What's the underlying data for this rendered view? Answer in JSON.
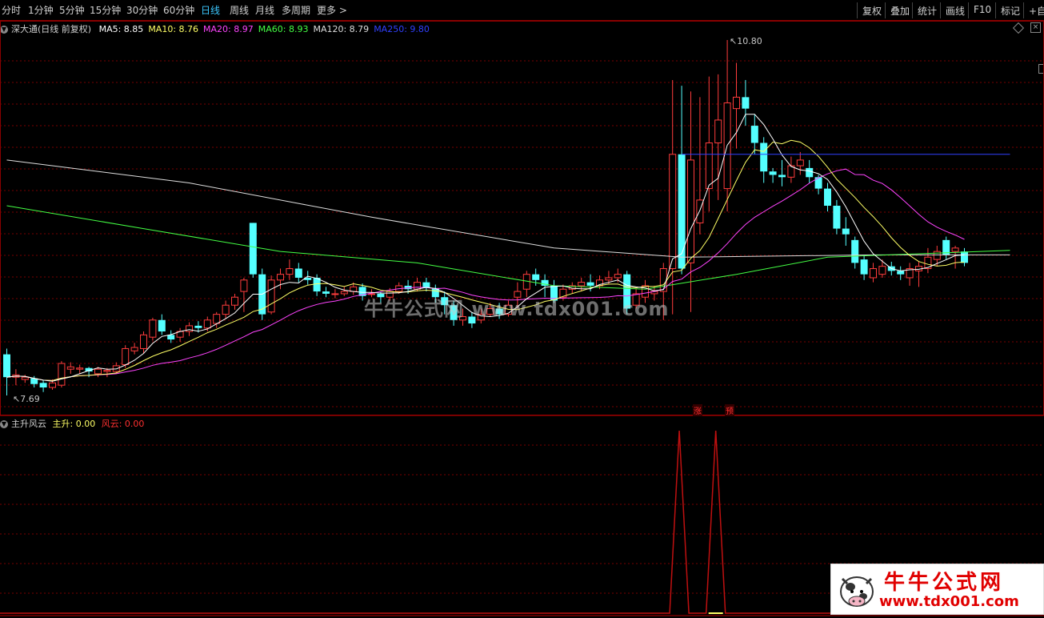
{
  "toolbar": {
    "periods": [
      "分时",
      "1分钟",
      "5分钟",
      "15分钟",
      "30分钟",
      "60分钟",
      "日线",
      "周线",
      "月线",
      "多周期",
      "更多 >"
    ],
    "active_period": "日线",
    "right_buttons": [
      "复权",
      "叠加",
      "统计",
      "画线",
      "F10",
      "标记",
      "+自"
    ]
  },
  "legend": {
    "title": "深大通(日线 前复权)",
    "ma": [
      {
        "label": "MA5: 8.85",
        "color": "#ffffff"
      },
      {
        "label": "MA10: 8.76",
        "color": "#ffff66"
      },
      {
        "label": "MA20: 8.97",
        "color": "#ff44ff"
      },
      {
        "label": "MA60: 8.93",
        "color": "#44ff44"
      },
      {
        "label": "MA120: 8.79",
        "color": "#dddddd"
      },
      {
        "label": "MA250: 9.80",
        "color": "#3040ff"
      }
    ]
  },
  "indicator_legend": {
    "name": "主升风云",
    "s1": "主升: 0.00",
    "s1_color": "#ffff66",
    "s2": "风云: 0.00",
    "s2_color": "#ff3030"
  },
  "price_marks": {
    "high": "10.80",
    "low": "7.69"
  },
  "signal_marks": [
    "涨",
    "预"
  ],
  "watermark": "牛牛公式网 www.tdx001.com",
  "logo": {
    "title": "牛牛公式网",
    "url": "www.tdx001.com"
  },
  "colors": {
    "up": "#ff3c3c",
    "down": "#54ffff",
    "grid": "#7a0000",
    "signal": "#c01010"
  },
  "chart_data": {
    "type": "candlestick",
    "candles": [
      [
        8.05,
        7.85,
        8.1,
        7.69
      ],
      [
        7.85,
        7.87,
        7.92,
        7.78
      ],
      [
        7.83,
        7.85,
        7.87,
        7.8
      ],
      [
        7.84,
        7.79,
        7.86,
        7.76
      ],
      [
        7.8,
        7.76,
        7.82,
        7.72
      ],
      [
        7.76,
        7.8,
        7.83,
        7.74
      ],
      [
        7.78,
        7.97,
        7.99,
        7.76
      ],
      [
        7.92,
        7.94,
        7.98,
        7.88
      ],
      [
        7.92,
        7.93,
        7.96,
        7.88
      ],
      [
        7.93,
        7.9,
        7.94,
        7.85
      ],
      [
        7.88,
        7.92,
        7.94,
        7.85
      ],
      [
        7.9,
        7.91,
        7.93,
        7.85
      ],
      [
        7.9,
        7.95,
        7.98,
        7.88
      ],
      [
        7.96,
        8.1,
        8.13,
        7.93
      ],
      [
        8.08,
        8.11,
        8.15,
        8.05
      ],
      [
        8.1,
        8.22,
        8.25,
        8.06
      ],
      [
        8.2,
        8.35,
        8.37,
        8.17
      ],
      [
        8.35,
        8.25,
        8.4,
        8.22
      ],
      [
        8.22,
        8.18,
        8.26,
        8.15
      ],
      [
        8.2,
        8.25,
        8.28,
        8.16
      ],
      [
        8.25,
        8.3,
        8.33,
        8.21
      ],
      [
        8.3,
        8.28,
        8.34,
        8.24
      ],
      [
        8.28,
        8.35,
        8.38,
        8.25
      ],
      [
        8.32,
        8.4,
        8.42,
        8.28
      ],
      [
        8.4,
        8.48,
        8.52,
        8.36
      ],
      [
        8.48,
        8.55,
        8.58,
        8.44
      ],
      [
        8.6,
        8.7,
        8.72,
        8.42
      ],
      [
        9.2,
        8.75,
        9.2,
        8.72
      ],
      [
        8.75,
        8.4,
        8.8,
        8.35
      ],
      [
        8.42,
        8.7,
        8.74,
        8.4
      ],
      [
        8.7,
        8.75,
        8.8,
        8.62
      ],
      [
        8.75,
        8.8,
        8.88,
        8.7
      ],
      [
        8.8,
        8.72,
        8.85,
        8.68
      ],
      [
        8.72,
        8.7,
        8.78,
        8.66
      ],
      [
        8.72,
        8.6,
        8.75,
        8.56
      ],
      [
        8.6,
        8.58,
        8.64,
        8.55
      ],
      [
        8.58,
        8.58,
        8.62,
        8.54
      ],
      [
        8.58,
        8.6,
        8.64,
        8.56
      ],
      [
        8.6,
        8.64,
        8.68,
        8.57
      ],
      [
        8.64,
        8.56,
        8.67,
        8.52
      ],
      [
        8.58,
        8.58,
        8.62,
        8.55
      ],
      [
        8.58,
        8.55,
        8.6,
        8.5
      ],
      [
        8.55,
        8.6,
        8.63,
        8.52
      ],
      [
        8.6,
        8.65,
        8.68,
        8.58
      ],
      [
        8.65,
        8.62,
        8.7,
        8.58
      ],
      [
        8.62,
        8.68,
        8.72,
        8.6
      ],
      [
        8.68,
        8.63,
        8.72,
        8.6
      ],
      [
        8.63,
        8.55,
        8.66,
        8.5
      ],
      [
        8.55,
        8.48,
        8.6,
        8.4
      ],
      [
        8.48,
        8.35,
        8.52,
        8.3
      ],
      [
        8.35,
        8.38,
        8.45,
        8.3
      ],
      [
        8.38,
        8.32,
        8.42,
        8.28
      ],
      [
        8.35,
        8.4,
        8.45,
        8.32
      ],
      [
        8.4,
        8.45,
        8.5,
        8.38
      ],
      [
        8.45,
        8.4,
        8.5,
        8.36
      ],
      [
        8.4,
        8.48,
        8.52,
        8.38
      ],
      [
        8.55,
        8.6,
        8.68,
        8.45
      ],
      [
        8.62,
        8.75,
        8.78,
        8.55
      ],
      [
        8.75,
        8.7,
        8.8,
        8.65
      ],
      [
        8.7,
        8.65,
        8.75,
        8.55
      ],
      [
        8.65,
        8.52,
        8.7,
        8.5
      ],
      [
        8.55,
        8.62,
        8.66,
        8.52
      ],
      [
        8.62,
        8.65,
        8.68,
        8.58
      ],
      [
        8.65,
        8.68,
        8.72,
        8.6
      ],
      [
        8.68,
        8.65,
        8.75,
        8.6
      ],
      [
        8.65,
        8.7,
        8.74,
        8.62
      ],
      [
        8.7,
        8.72,
        8.78,
        8.66
      ],
      [
        8.72,
        8.75,
        8.8,
        8.68
      ],
      [
        8.75,
        8.45,
        8.78,
        8.4
      ],
      [
        8.48,
        8.58,
        8.62,
        8.45
      ],
      [
        8.55,
        8.65,
        8.7,
        8.5
      ],
      [
        8.58,
        8.6,
        8.65,
        8.52
      ],
      [
        8.6,
        8.8,
        8.85,
        8.35
      ],
      [
        8.8,
        9.8,
        10.45,
        8.4
      ],
      [
        9.8,
        8.8,
        10.4,
        8.75
      ],
      [
        8.85,
        9.75,
        10.35,
        8.42
      ],
      [
        9.2,
        9.4,
        10.3,
        9.1
      ],
      [
        9.5,
        9.9,
        10.48,
        9.3
      ],
      [
        9.9,
        10.1,
        10.5,
        9.4
      ],
      [
        9.5,
        10.25,
        10.8,
        9.3
      ],
      [
        10.2,
        10.3,
        10.6,
        9.85
      ],
      [
        10.3,
        10.2,
        10.45,
        10.05
      ],
      [
        10.05,
        9.9,
        10.15,
        9.8
      ],
      [
        9.9,
        9.65,
        9.95,
        9.55
      ],
      [
        9.65,
        9.62,
        9.68,
        9.55
      ],
      [
        9.62,
        9.6,
        9.75,
        9.52
      ],
      [
        9.6,
        9.7,
        9.78,
        9.55
      ],
      [
        9.7,
        9.75,
        9.82,
        9.62
      ],
      [
        9.68,
        9.6,
        9.75,
        9.55
      ],
      [
        9.6,
        9.5,
        9.62,
        9.45
      ],
      [
        9.5,
        9.35,
        9.55,
        9.3
      ],
      [
        9.35,
        9.15,
        9.4,
        9.1
      ],
      [
        9.15,
        9.1,
        9.25,
        9.0
      ],
      [
        9.05,
        8.85,
        9.08,
        8.8
      ],
      [
        8.88,
        8.75,
        8.92,
        8.7
      ],
      [
        8.72,
        8.8,
        8.85,
        8.68
      ],
      [
        8.75,
        8.82,
        8.88,
        8.72
      ],
      [
        8.82,
        8.78,
        8.86,
        8.74
      ],
      [
        8.78,
        8.75,
        8.82,
        8.7
      ],
      [
        8.72,
        8.8,
        8.85,
        8.65
      ],
      [
        8.78,
        8.82,
        8.86,
        8.64
      ],
      [
        8.8,
        8.9,
        8.98,
        8.76
      ],
      [
        8.88,
        8.95,
        9.0,
        8.82
      ],
      [
        9.05,
        8.92,
        9.08,
        8.88
      ],
      [
        8.95,
        8.98,
        9.0,
        8.8
      ],
      [
        8.95,
        8.85,
        8.98,
        8.82
      ]
    ],
    "ma": {
      "MA5": {
        "color": "#ffffff"
      },
      "MA10": {
        "color": "#ffff66"
      },
      "MA20": {
        "color": "#ff44ff"
      },
      "MA60": {
        "color": "#44ff44"
      },
      "MA120": {
        "color": "#dddddd"
      },
      "MA250": {
        "color": "#3040ff"
      }
    },
    "ma120_series": [
      [
        0,
        9.75
      ],
      [
        20,
        9.55
      ],
      [
        40,
        9.25
      ],
      [
        60,
        8.98
      ],
      [
        74,
        8.9
      ],
      [
        95,
        8.92
      ],
      [
        110,
        8.92
      ]
    ],
    "ma60_series": [
      [
        0,
        9.35
      ],
      [
        15,
        9.15
      ],
      [
        30,
        8.95
      ],
      [
        45,
        8.85
      ],
      [
        60,
        8.65
      ],
      [
        70,
        8.62
      ],
      [
        80,
        8.75
      ],
      [
        90,
        8.9
      ],
      [
        110,
        8.96
      ]
    ],
    "ma250_series": [
      [
        74,
        9.8
      ],
      [
        110,
        9.8
      ]
    ],
    "ma250_start": 74,
    "ymin": 7.69,
    "ymax": 10.8,
    "indicator": {
      "type": "line",
      "peaks_at": [
        74,
        78
      ],
      "peak_value": 1,
      "base_value": 0
    }
  }
}
